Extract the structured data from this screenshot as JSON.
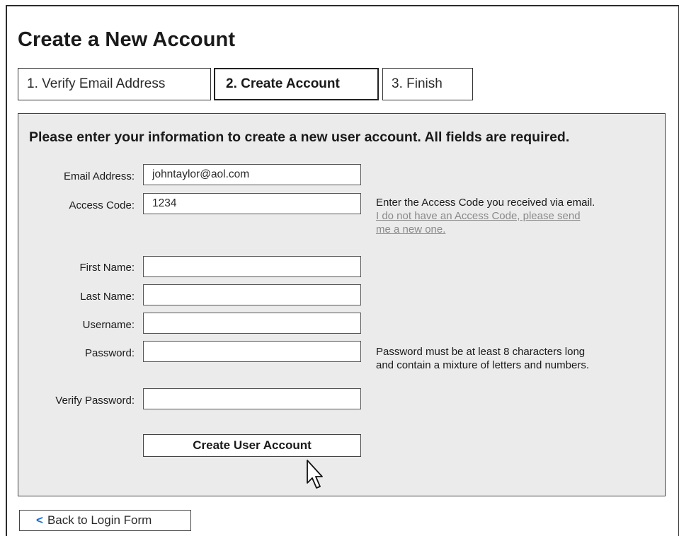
{
  "page": {
    "title": "Create a New Account"
  },
  "steps": [
    {
      "label": "1. Verify Email Address",
      "active": false
    },
    {
      "label": "2. Create Account",
      "active": true
    },
    {
      "label": "3. Finish",
      "active": false
    }
  ],
  "form": {
    "intro": "Please enter your information to create a new user account. All fields are required.",
    "fields": {
      "email": {
        "label": "Email Address:",
        "value": "johntaylor@aol.com"
      },
      "access_code": {
        "label": "Access Code:",
        "value": "1234"
      },
      "first_name": {
        "label": "First Name:",
        "value": ""
      },
      "last_name": {
        "label": "Last Name:",
        "value": ""
      },
      "username": {
        "label": "Username:",
        "value": ""
      },
      "password": {
        "label": "Password:",
        "value": ""
      },
      "verify_password": {
        "label": "Verify Password:",
        "value": ""
      }
    },
    "access_code_help": "Enter the Access Code you received via email.",
    "access_code_link_line1": "I do not have an Access Code, please send",
    "access_code_link_line2": "me a new one.",
    "password_help_line1": "Password must be at least 8 characters long",
    "password_help_line2": "and contain a mixture of letters and numbers.",
    "submit_label": "Create User Account"
  },
  "back": {
    "chevron": "<",
    "label": "Back to Login Form"
  },
  "colors": {
    "panel_bg": "#ebebeb",
    "link": "#8a8a8a",
    "accent": "#1a6fd0"
  }
}
